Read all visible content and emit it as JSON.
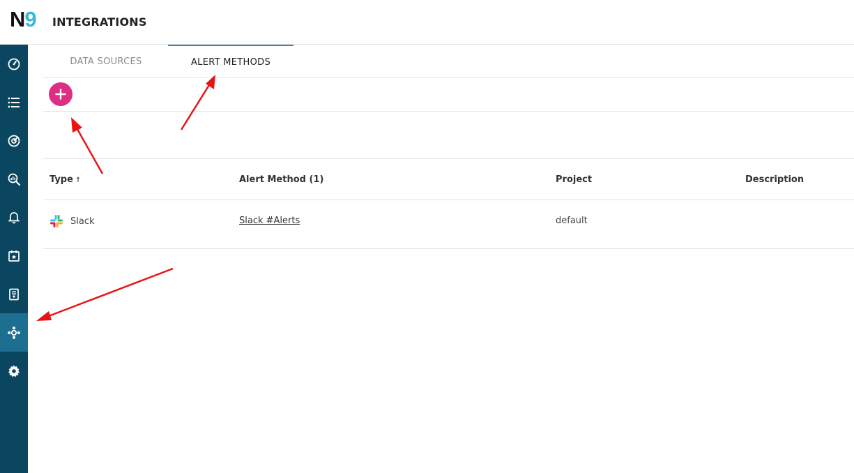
{
  "header": {
    "logo_n": "N",
    "logo_nine": "9",
    "title": "INTEGRATIONS"
  },
  "sidebar": {
    "items": [
      {
        "icon": "gauge-icon"
      },
      {
        "icon": "list-icon"
      },
      {
        "icon": "target-icon"
      },
      {
        "icon": "search-chart-icon"
      },
      {
        "icon": "bell-icon"
      },
      {
        "icon": "calendar-star-icon"
      },
      {
        "icon": "report-icon"
      },
      {
        "icon": "integrations-icon",
        "active": true
      },
      {
        "icon": "gear-icon"
      }
    ]
  },
  "tabs": [
    {
      "label": "DATA SOURCES",
      "active": false
    },
    {
      "label": "ALERT METHODS",
      "active": true
    }
  ],
  "toolbar": {
    "add_icon": "plus-icon"
  },
  "table": {
    "headers": {
      "type": "Type",
      "sort_arrow": "↑",
      "alert_method": "Alert Method (1)",
      "project": "Project",
      "description": "Description"
    },
    "rows": [
      {
        "type": "Slack",
        "alert_method": "Slack #Alerts",
        "project": "default",
        "description": ""
      }
    ]
  },
  "colors": {
    "sidebar": "#0b4660",
    "sidebar_active": "#1d6f92",
    "add_button": "#dc2f83",
    "tab_indicator": "#3987b8",
    "annotation_arrow": "#e81414"
  }
}
